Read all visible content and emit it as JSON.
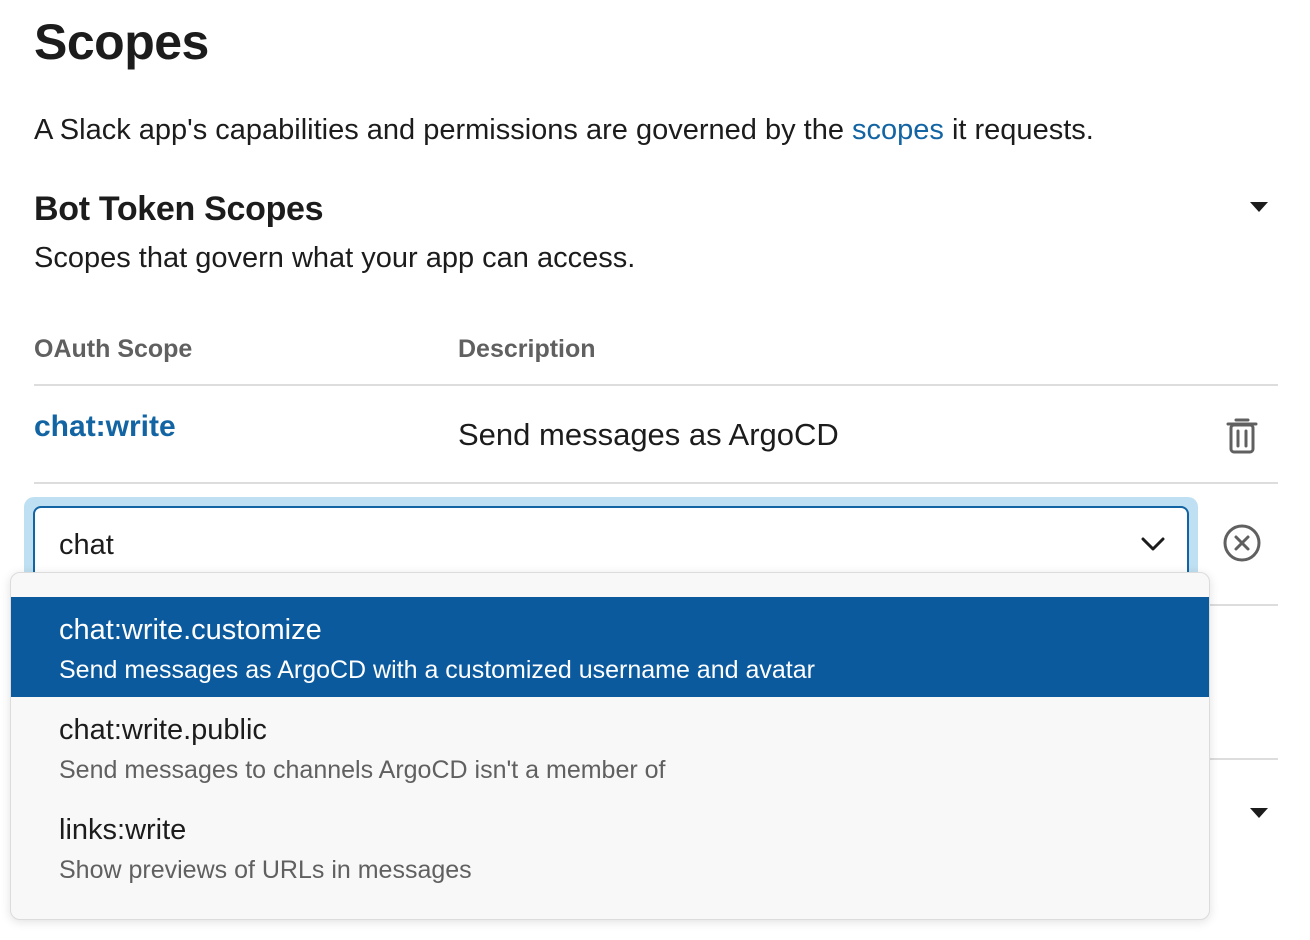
{
  "page": {
    "title": "Scopes",
    "intro": {
      "before": "A Slack app's capabilities and permissions are governed by the ",
      "link": "scopes",
      "after": " it requests."
    }
  },
  "section": {
    "title": "Bot Token Scopes",
    "description": "Scopes that govern what your app can access.",
    "toggle_icon": "caret-down-icon"
  },
  "table": {
    "columns": [
      "OAuth Scope",
      "Description"
    ],
    "rows": [
      {
        "scope": "chat:write",
        "description": "Send messages as ArgoCD",
        "action_icon": "trash-icon"
      }
    ]
  },
  "scope_select": {
    "value": "chat",
    "chevron_icon": "chevron-down-icon",
    "clear_icon": "circle-x-icon",
    "options": [
      {
        "name": "chat:write.customize",
        "description": "Send messages as ArgoCD with a customized username and avatar",
        "selected": true
      },
      {
        "name": "chat:write.public",
        "description": "Send messages to channels ArgoCD isn't a member of",
        "selected": false
      },
      {
        "name": "links:write",
        "description": "Show previews of URLs in messages",
        "selected": false
      }
    ]
  },
  "colors": {
    "link": "#1264a3",
    "selected_option_bg": "#0b5a9e",
    "focus_ring": "#bfe0f2",
    "muted_text": "#616061"
  }
}
